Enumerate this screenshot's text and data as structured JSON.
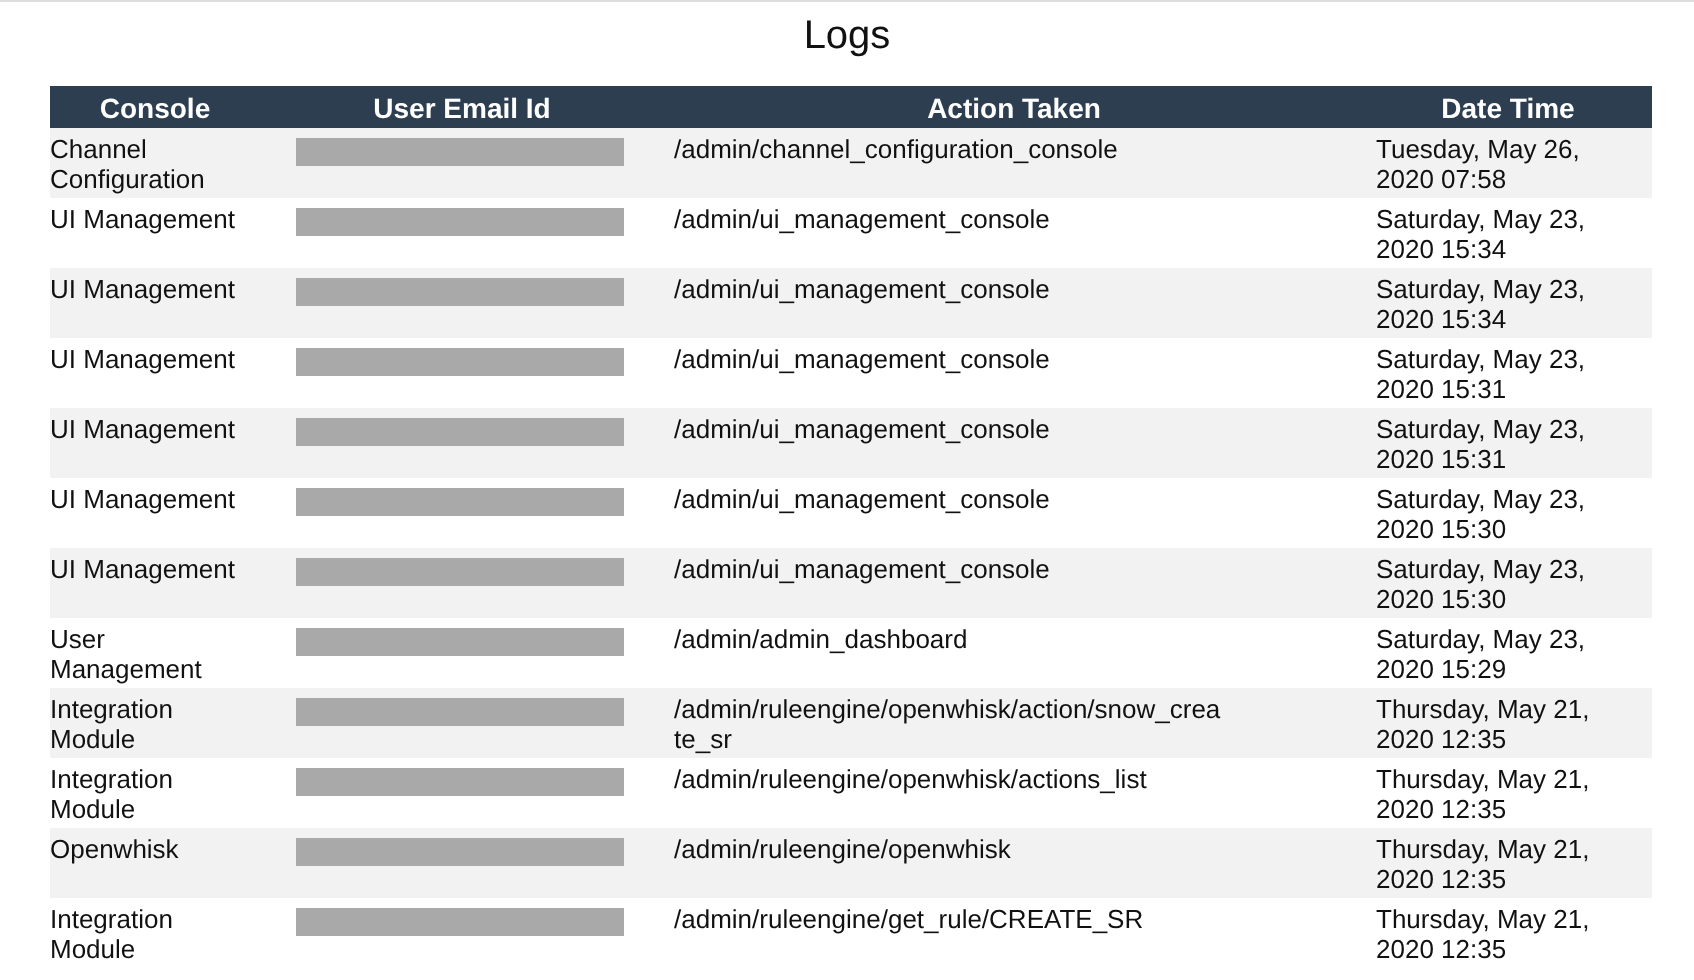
{
  "title": "Logs",
  "table": {
    "columns": [
      "Console",
      "User Email Id",
      "Action Taken",
      "Date Time"
    ],
    "rows": [
      {
        "console": "Channel Configuration",
        "action": "/admin/channel_configuration_console",
        "date_time": "Tuesday, May 26, 2020 07:58"
      },
      {
        "console": "UI Management",
        "action": "/admin/ui_management_console",
        "date_time": "Saturday, May 23, 2020 15:34"
      },
      {
        "console": "UI Management",
        "action": "/admin/ui_management_console",
        "date_time": "Saturday, May 23, 2020 15:34"
      },
      {
        "console": "UI Management",
        "action": "/admin/ui_management_console",
        "date_time": "Saturday, May 23, 2020 15:31"
      },
      {
        "console": "UI Management",
        "action": "/admin/ui_management_console",
        "date_time": "Saturday, May 23, 2020 15:31"
      },
      {
        "console": "UI Management",
        "action": "/admin/ui_management_console",
        "date_time": "Saturday, May 23, 2020 15:30"
      },
      {
        "console": "UI Management",
        "action": "/admin/ui_management_console",
        "date_time": "Saturday, May 23, 2020 15:30"
      },
      {
        "console": "User Management",
        "action": "/admin/admin_dashboard",
        "date_time": "Saturday, May 23, 2020 15:29"
      },
      {
        "console": "Integration Module",
        "action": "/admin/ruleengine/openwhisk/action/snow_create_sr",
        "date_time": "Thursday, May 21, 2020 12:35"
      },
      {
        "console": "Integration Module",
        "action": "/admin/ruleengine/openwhisk/actions_list",
        "date_time": "Thursday, May 21, 2020 12:35"
      },
      {
        "console": "Openwhisk",
        "action": "/admin/ruleengine/openwhisk",
        "date_time": "Thursday, May 21, 2020 12:35"
      },
      {
        "console": "Integration Module",
        "action": "/admin/ruleengine/get_rule/CREATE_SR",
        "date_time": "Thursday, May 21, 2020 12:35"
      }
    ]
  }
}
